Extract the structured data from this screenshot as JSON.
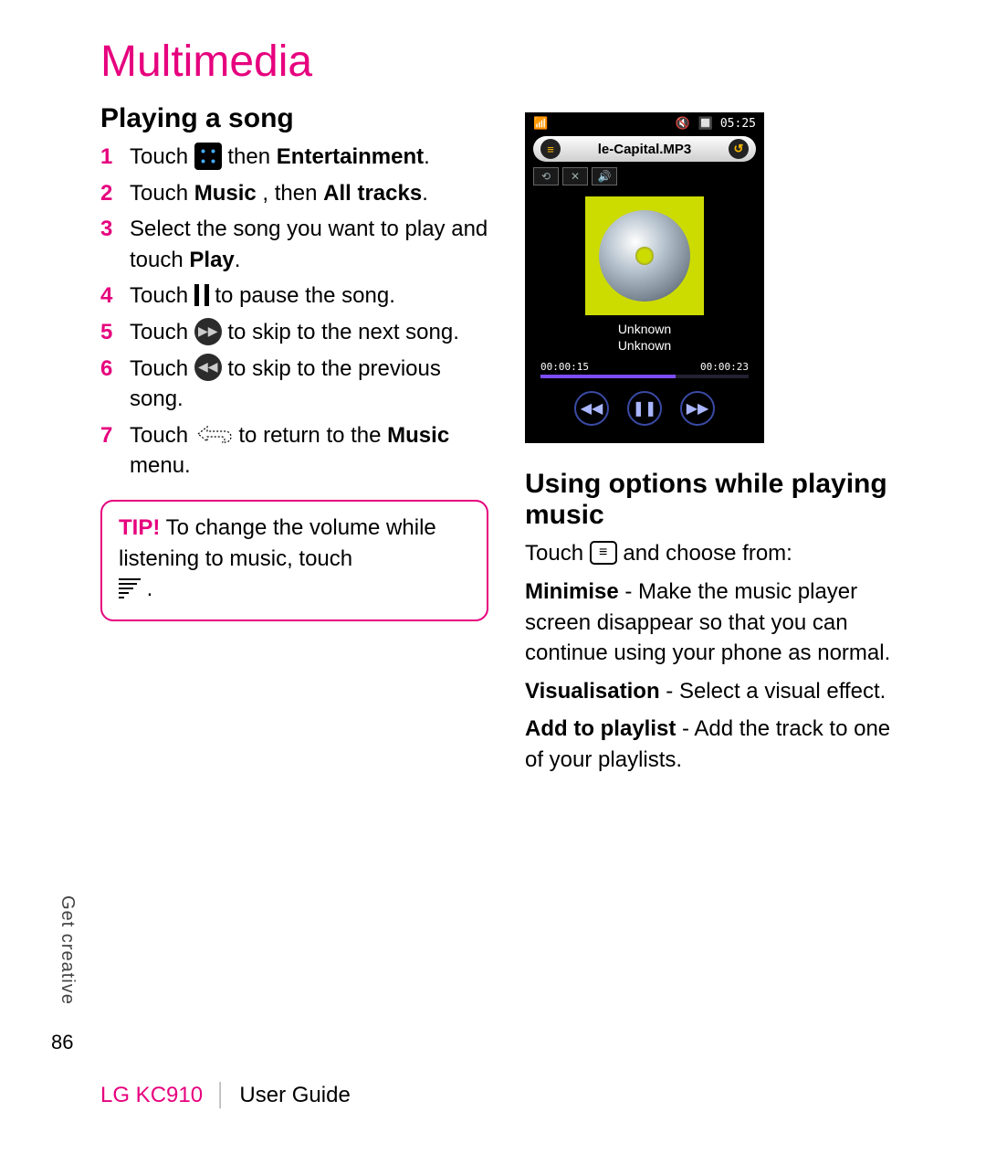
{
  "chapter_title": "Multimedia",
  "section1_title": "Playing a song",
  "steps": {
    "s1_a": "Touch ",
    "s1_b": " then ",
    "s1_bold": "Entertainment",
    "s1_end": ".",
    "s2_a": "Touch ",
    "s2_bold1": "Music",
    "s2_mid": ", then ",
    "s2_bold2": "All tracks",
    "s2_end": ".",
    "s3": "Select the song you want to play and touch ",
    "s3_bold": "Play",
    "s3_end": ".",
    "s4_a": "Touch ",
    "s4_b": " to pause the song.",
    "s5_a": "Touch ",
    "s5_b": "  to skip to the next song.",
    "s6_a": "Touch ",
    "s6_b": "  to skip to the previous song.",
    "s7_a": "Touch ",
    "s7_b": " to return to the ",
    "s7_bold": "Music",
    "s7_end": " menu."
  },
  "tip": {
    "label": "TIP!",
    "text_a": " To change the volume while listening to music, touch ",
    "text_b": " ."
  },
  "phone": {
    "signal_glyph": "📶",
    "mute_glyph": "🔇",
    "battery_glyph": "🔲",
    "clock": "05:25",
    "title": "le-Capital.MP3",
    "meta1": "Unknown",
    "meta2": "Unknown",
    "time_elapsed": "00:00:15",
    "time_total": "00:00:23"
  },
  "section2_title": "Using options while playing music",
  "section2_intro_a": "Touch ",
  "section2_intro_b": " and choose from:",
  "options": {
    "o1_label": "Minimise",
    "o1_text": " - Make the music player screen disappear so that you can continue using your phone as normal.",
    "o2_label": "Visualisation",
    "o2_text": " - Select a visual effect.",
    "o3_label": "Add to playlist",
    "o3_text": " - Add the track to one of your playlists."
  },
  "side_tab": "Get creative",
  "page_number": "86",
  "footer_model": "LG KC910",
  "footer_guide": "User Guide"
}
